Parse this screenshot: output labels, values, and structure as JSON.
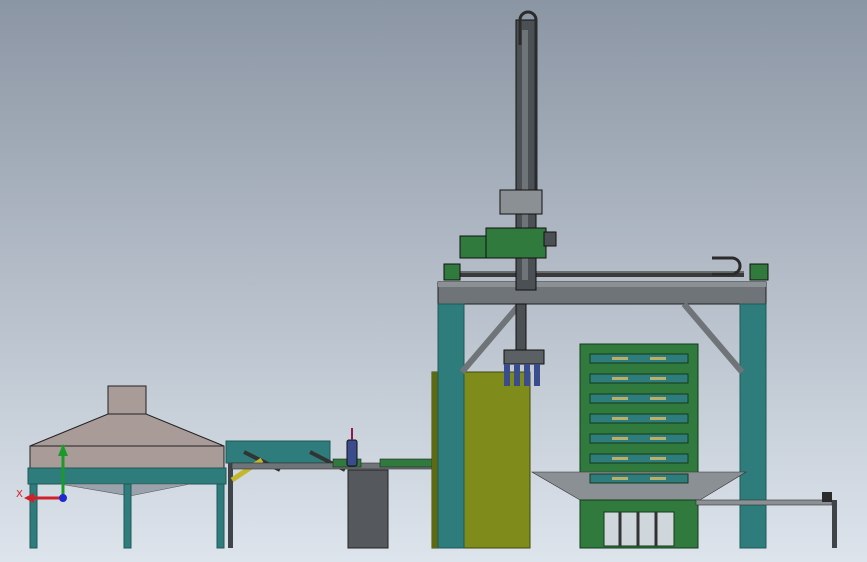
{
  "triad": {
    "x_label": "X",
    "y_label": "Y"
  },
  "colors": {
    "bg_top": "#8b96a4",
    "bg_bottom": "#dde4ec",
    "teal": "#2e7c7b",
    "teal_dark": "#1f5a59",
    "steel": "#6e7478",
    "steel_dark": "#3e4448",
    "olive": "#7f8c1c",
    "olive_dark": "#5e6a12",
    "green_rack": "#2f7a3c",
    "hood": "#a99b98",
    "axis_x": "#d0202a",
    "axis_y": "#1a9a2a",
    "axis_z": "#1e2ad0"
  }
}
